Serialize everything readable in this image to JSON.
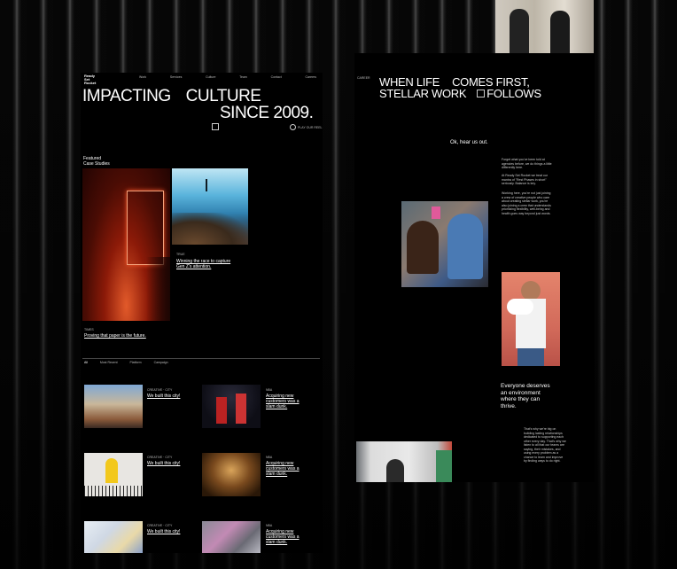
{
  "left": {
    "brand": [
      "Ready",
      "Set",
      "Rocket"
    ],
    "nav": [
      "Work",
      "Services",
      "Culture",
      "Team",
      "Contact",
      "Careers"
    ],
    "hero_line1_a": "IMPACTING",
    "hero_line1_b": "CULTURE",
    "hero_line2": "SINCE 2009.",
    "play_label": "PLAY OUR REEL",
    "featured": [
      "Featured",
      "Case Studies"
    ],
    "case1_tag": "TRUE",
    "case1_link": "Winning the race to capture Gen Z's attention.",
    "case2_tag": "TIMES",
    "case2_link": "Proving that paper is the future.",
    "filters": [
      "All",
      "Most Recent",
      "Platform",
      "Campaign"
    ],
    "grid": [
      {
        "tag": "CREATIVE · CITY",
        "link": "We built this city!"
      },
      {
        "tag": "NBA",
        "link": "Acquiring new customers was a slam dunk."
      },
      {
        "tag": "CREATIVE · CITY",
        "link": "We built this city!"
      },
      {
        "tag": "NBA",
        "link": "Acquiring new customers was a slam dunk."
      },
      {
        "tag": "CREATIVE · CITY",
        "link": "We built this city!"
      },
      {
        "tag": "NBA",
        "link": "Acquiring new customers was a slam dunk."
      }
    ]
  },
  "right": {
    "label": "CAREER",
    "head1_a": "WHEN LIFE",
    "head1_b": "COMES FIRST,",
    "head2_a": "STELLAR WORK",
    "head2_b": "FOLLOWS",
    "hear": "Ok, hear us out.",
    "para1": "Forget what you've been told at agencies before, we do things a little differently here.",
    "para2": "At Ready Set Rocket we treat our mantra of \"Rest Phases in short\" seriously. Balance is key.",
    "para3": "Working here, you're not just joining a crew of creative people who care about creating stellar work, you're also joining a crew that understands prioritizing flexibility, well-being and health goes way beyond just words.",
    "everyone": "Everyone deserves an environment where they can thrive.",
    "para4": "That's why we're big on building lasting relationships dedicated to supporting each other every day. That's why we listen to all that our teams are saying, their mistakes, and using every problem as a chance to learn and improve by finding ways to do right."
  }
}
